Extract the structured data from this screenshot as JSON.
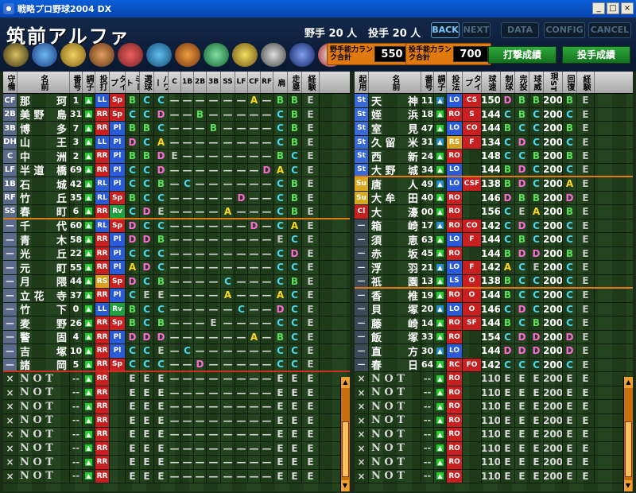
{
  "window": {
    "title": "戦略プロ野球2004 DX"
  },
  "team": {
    "name": "筑前アルファ",
    "fielders": "野手 20 人",
    "pitchers": "投手 20 人"
  },
  "topnav": [
    "BACK",
    "NEXT",
    "DATA",
    "CONFIG",
    "CANCEL"
  ],
  "rank": {
    "fielder_label": "野手能力ランク合計",
    "fielder_value": "550",
    "pitcher_label": "投手能力ランク合計",
    "pitcher_value": "700"
  },
  "buttons": {
    "batting": "打撃成績",
    "pitching": "投手成績"
  },
  "colors": {
    "grade_A": "#ffd820",
    "grade_B": "#5ae05a",
    "grade_C": "#4ad8f0",
    "grade_D": "#ff6ad8",
    "grade_E": "#c8c8c8",
    "orange": "#e07a10"
  },
  "fielder_headers": [
    "守備",
    "名前",
    "番号",
    "調子",
    "投打",
    "タイプ",
    "ミート",
    "選球",
    "パワー",
    "C",
    "1B",
    "2B",
    "3B",
    "SS",
    "LF",
    "CF",
    "RF",
    "肩",
    "走塁",
    "経験"
  ],
  "pitcher_headers": [
    "起用",
    "名前",
    "番号",
    "調子",
    "投法",
    "タイプ",
    "球速",
    "制球",
    "完投",
    "球威",
    "現ST",
    "回復",
    "経験"
  ],
  "fielders": [
    {
      "pos": "CF",
      "n1": "那",
      "n2": "珂",
      "num": "1",
      "bat": "LL",
      "typ": "Sp",
      "m": "B",
      "s": "C",
      "p": "C",
      "f": [
        "",
        "",
        "",
        "",
        "",
        "",
        "A",
        ""
      ],
      "arm": "B",
      "run": "B",
      "exp": "E"
    },
    {
      "pos": "2B",
      "n1": "美 野",
      "n2": "島",
      "num": "31",
      "bat": "RR",
      "typ": "Sp",
      "m": "C",
      "s": "C",
      "p": "D",
      "f": [
        "",
        "",
        "B",
        "",
        "",
        "",
        "",
        ""
      ],
      "arm": "C",
      "run": "B",
      "exp": "E"
    },
    {
      "pos": "3B",
      "n1": "博",
      "n2": "多",
      "num": "7",
      "bat": "RR",
      "typ": "Pl",
      "m": "B",
      "s": "B",
      "p": "C",
      "f": [
        "",
        "",
        "",
        "B",
        "",
        "",
        "",
        ""
      ],
      "arm": "C",
      "run": "B",
      "exp": "E"
    },
    {
      "pos": "DH",
      "n1": "山",
      "n2": "王",
      "num": "3",
      "bat": "LL",
      "typ": "Pl",
      "m": "D",
      "s": "C",
      "p": "A",
      "f": [
        "",
        "",
        "",
        "",
        "",
        "",
        "",
        ""
      ],
      "arm": "C",
      "run": "B",
      "exp": "E"
    },
    {
      "pos": "C",
      "n1": "中",
      "n2": "洲",
      "num": "2",
      "bat": "RR",
      "typ": "Pl",
      "m": "B",
      "s": "B",
      "p": "D",
      "f": [
        "E",
        "",
        "",
        "",
        "",
        "",
        "",
        ""
      ],
      "arm": "B",
      "run": "C",
      "exp": "E"
    },
    {
      "pos": "LF",
      "n1": "半 道",
      "n2": "橋",
      "num": "69",
      "bat": "RR",
      "typ": "Pl",
      "m": "C",
      "s": "C",
      "p": "D",
      "f": [
        "",
        "",
        "",
        "",
        "",
        "",
        "",
        "D"
      ],
      "arm": "A",
      "run": "C",
      "exp": "E"
    },
    {
      "pos": "1B",
      "n1": "石",
      "n2": "城",
      "num": "42",
      "bat": "RL",
      "typ": "Pl",
      "m": "C",
      "s": "C",
      "p": "B",
      "f": [
        "",
        "C",
        "",
        "",
        "",
        "",
        "",
        ""
      ],
      "arm": "C",
      "run": "B",
      "exp": "E"
    },
    {
      "pos": "RF",
      "n1": "竹",
      "n2": "丘",
      "num": "35",
      "bat": "RL",
      "typ": "Sp",
      "m": "B",
      "s": "C",
      "p": "C",
      "f": [
        "",
        "",
        "",
        "",
        "",
        "D",
        "",
        ""
      ],
      "arm": "C",
      "run": "B",
      "exp": "E"
    },
    {
      "pos": "SS",
      "n1": "春",
      "n2": "町",
      "num": "6",
      "bat": "RR",
      "typ": "Rv",
      "m": "C",
      "s": "D",
      "p": "E",
      "f": [
        "",
        "",
        "",
        "",
        "A",
        "",
        "",
        ""
      ],
      "arm": "C",
      "run": "B",
      "exp": "E"
    },
    {
      "pos": "一",
      "n1": "千",
      "n2": "代",
      "num": "60",
      "bat": "RL",
      "typ": "Sp",
      "m": "D",
      "s": "C",
      "p": "C",
      "f": [
        "",
        "",
        "",
        "",
        "",
        "",
        "D",
        ""
      ],
      "arm": "C",
      "run": "A",
      "exp": "E"
    },
    {
      "pos": "一",
      "n1": "青",
      "n2": "木",
      "num": "58",
      "bat": "RR",
      "typ": "Pl",
      "m": "D",
      "s": "D",
      "p": "B",
      "f": [
        "",
        "",
        "",
        "",
        "",
        "",
        "",
        ""
      ],
      "arm": "E",
      "run": "C",
      "exp": "E"
    },
    {
      "pos": "一",
      "n1": "光",
      "n2": "丘",
      "num": "22",
      "bat": "RR",
      "typ": "Pl",
      "m": "C",
      "s": "C",
      "p": "C",
      "f": [
        "",
        "",
        "",
        "",
        "",
        "",
        "",
        ""
      ],
      "arm": "C",
      "run": "D",
      "exp": "E"
    },
    {
      "pos": "一",
      "n1": "元",
      "n2": "町",
      "num": "55",
      "bat": "RR",
      "typ": "Pl",
      "m": "A",
      "s": "D",
      "p": "C",
      "f": [
        "",
        "",
        "",
        "",
        "",
        "",
        "",
        ""
      ],
      "arm": "C",
      "run": "C",
      "exp": "E"
    },
    {
      "pos": "一",
      "n1": "月",
      "n2": "隈",
      "num": "44",
      "bat": "RS",
      "typ": "Sp",
      "m": "D",
      "s": "C",
      "p": "B",
      "f": [
        "",
        "",
        "",
        "",
        "C",
        "",
        "",
        ""
      ],
      "arm": "C",
      "run": "B",
      "exp": "E"
    },
    {
      "pos": "一",
      "n1": "立 花",
      "n2": "寺",
      "num": "37",
      "bat": "RR",
      "typ": "Pl",
      "m": "C",
      "s": "E",
      "p": "E",
      "f": [
        "",
        "",
        "",
        "",
        "A",
        "",
        "",
        ""
      ],
      "arm": "A",
      "run": "C",
      "exp": "E"
    },
    {
      "pos": "一",
      "n1": "竹",
      "n2": "下",
      "num": "0",
      "bat": "LL",
      "typ": "Rv",
      "m": "B",
      "s": "C",
      "p": "C",
      "f": [
        "",
        "",
        "",
        "",
        "",
        "C",
        "",
        ""
      ],
      "arm": "D",
      "run": "C",
      "exp": "E"
    },
    {
      "pos": "一",
      "n1": "麦",
      "n2": "野",
      "num": "26",
      "bat": "RR",
      "typ": "Sp",
      "m": "B",
      "s": "C",
      "p": "B",
      "f": [
        "",
        "",
        "",
        "E",
        "",
        "",
        "",
        ""
      ],
      "arm": "C",
      "run": "C",
      "exp": "E"
    },
    {
      "pos": "一",
      "n1": "警",
      "n2": "固",
      "num": "4",
      "bat": "RR",
      "typ": "Pl",
      "m": "D",
      "s": "D",
      "p": "D",
      "f": [
        "",
        "",
        "",
        "",
        "",
        "",
        "A",
        ""
      ],
      "arm": "B",
      "run": "C",
      "exp": "E"
    },
    {
      "pos": "一",
      "n1": "吉",
      "n2": "塚",
      "num": "10",
      "bat": "RR",
      "typ": "Pl",
      "m": "C",
      "s": "C",
      "p": "E",
      "f": [
        "",
        "C",
        "",
        "",
        "",
        "",
        "",
        ""
      ],
      "arm": "C",
      "run": "C",
      "exp": "E"
    },
    {
      "pos": "一",
      "n1": "諸",
      "n2": "岡",
      "num": "5",
      "bat": "RR",
      "typ": "Sp",
      "m": "C",
      "s": "C",
      "p": "C",
      "f": [
        "",
        "",
        "D",
        "",
        "",
        "",
        "",
        ""
      ],
      "arm": "C",
      "run": "C",
      "exp": "E"
    }
  ],
  "pitchers": [
    {
      "role": "St",
      "n1": "天",
      "n2": "神",
      "num": "11",
      "hand": "LO",
      "typ": "CS",
      "v": "150",
      "ctl": "D",
      "cg": "B",
      "pw": "B",
      "st": "200",
      "rec": "B",
      "exp": "E"
    },
    {
      "role": "St",
      "n1": "姪",
      "n2": "浜",
      "num": "18",
      "hand": "RO",
      "typ": "S",
      "v": "144",
      "ctl": "C",
      "cg": "B",
      "pw": "C",
      "st": "200",
      "rec": "C",
      "exp": "E"
    },
    {
      "role": "St",
      "n1": "室",
      "n2": "見",
      "num": "47",
      "hand": "LO",
      "typ": "CO",
      "v": "144",
      "ctl": "B",
      "cg": "C",
      "pw": "C",
      "st": "200",
      "rec": "B",
      "exp": "E"
    },
    {
      "role": "St",
      "n1": "久 留",
      "n2": "米",
      "num": "31",
      "hand": "RS",
      "typ": "F",
      "v": "134",
      "ctl": "C",
      "cg": "D",
      "pw": "C",
      "st": "200",
      "rec": "C",
      "exp": "E"
    },
    {
      "role": "St",
      "n1": "西",
      "n2": "新",
      "num": "24",
      "hand": "RO",
      "typ": "",
      "v": "148",
      "ctl": "C",
      "cg": "C",
      "pw": "B",
      "st": "200",
      "rec": "B",
      "exp": "E"
    },
    {
      "role": "St",
      "n1": "大 野",
      "n2": "城",
      "num": "34",
      "hand": "LO",
      "typ": "",
      "v": "144",
      "ctl": "B",
      "cg": "D",
      "pw": "C",
      "st": "200",
      "rec": "C",
      "exp": "E"
    },
    {
      "role": "Su",
      "n1": "唐",
      "n2": "人",
      "num": "49",
      "hand": "LO",
      "typ": "CSF",
      "v": "138",
      "ctl": "B",
      "cg": "D",
      "pw": "C",
      "st": "200",
      "rec": "A",
      "exp": "E"
    },
    {
      "role": "Su",
      "n1": "大 牟",
      "n2": "田",
      "num": "40",
      "hand": "RO",
      "typ": "",
      "v": "146",
      "ctl": "D",
      "cg": "B",
      "pw": "B",
      "st": "200",
      "rec": "D",
      "exp": "E"
    },
    {
      "role": "Cl",
      "n1": "大",
      "n2": "濠",
      "num": "00",
      "hand": "RO",
      "typ": "",
      "v": "156",
      "ctl": "C",
      "cg": "E",
      "pw": "A",
      "st": "200",
      "rec": "B",
      "exp": "E"
    },
    {
      "role": "一",
      "n1": "箱",
      "n2": "崎",
      "num": "17",
      "hand": "RO",
      "typ": "CO",
      "v": "142",
      "ctl": "C",
      "cg": "D",
      "pw": "C",
      "st": "200",
      "rec": "C",
      "exp": "E"
    },
    {
      "role": "一",
      "n1": "須",
      "n2": "恵",
      "num": "63",
      "hand": "LO",
      "typ": "F",
      "v": "144",
      "ctl": "C",
      "cg": "B",
      "pw": "C",
      "st": "200",
      "rec": "C",
      "exp": "E"
    },
    {
      "role": "一",
      "n1": "赤",
      "n2": "坂",
      "num": "45",
      "hand": "RO",
      "typ": "",
      "v": "144",
      "ctl": "B",
      "cg": "D",
      "pw": "D",
      "st": "200",
      "rec": "B",
      "exp": "E"
    },
    {
      "role": "一",
      "n1": "浮",
      "n2": "羽",
      "num": "21",
      "hand": "LO",
      "typ": "F",
      "v": "142",
      "ctl": "A",
      "cg": "C",
      "pw": "E",
      "st": "200",
      "rec": "C",
      "exp": "E"
    },
    {
      "role": "一",
      "n1": "祇",
      "n2": "園",
      "num": "13",
      "hand": "LS",
      "typ": "O",
      "v": "138",
      "ctl": "B",
      "cg": "C",
      "pw": "C",
      "st": "200",
      "rec": "C",
      "exp": "E"
    },
    {
      "role": "一",
      "n1": "香",
      "n2": "椎",
      "num": "19",
      "hand": "RO",
      "typ": "O",
      "v": "144",
      "ctl": "B",
      "cg": "C",
      "pw": "C",
      "st": "200",
      "rec": "C",
      "exp": "E"
    },
    {
      "role": "一",
      "n1": "貝",
      "n2": "塚",
      "num": "20",
      "hand": "LO",
      "typ": "O",
      "v": "146",
      "ctl": "C",
      "cg": "D",
      "pw": "C",
      "st": "200",
      "rec": "C",
      "exp": "E"
    },
    {
      "role": "一",
      "n1": "藤",
      "n2": "崎",
      "num": "14",
      "hand": "RO",
      "typ": "SF",
      "v": "144",
      "ctl": "B",
      "cg": "C",
      "pw": "B",
      "st": "200",
      "rec": "C",
      "exp": "E"
    },
    {
      "role": "一",
      "n1": "飯",
      "n2": "塚",
      "num": "33",
      "hand": "RO",
      "typ": "",
      "v": "154",
      "ctl": "C",
      "cg": "D",
      "pw": "D",
      "st": "200",
      "rec": "D",
      "exp": "E"
    },
    {
      "role": "一",
      "n1": "直",
      "n2": "方",
      "num": "30",
      "hand": "LO",
      "typ": "",
      "v": "144",
      "ctl": "D",
      "cg": "D",
      "pw": "D",
      "st": "200",
      "rec": "D",
      "exp": "E"
    },
    {
      "role": "一",
      "n1": "春",
      "n2": "日",
      "num": "64",
      "hand": "RC",
      "typ": "FO",
      "v": "142",
      "ctl": "C",
      "cg": "C",
      "pw": "C",
      "st": "200",
      "rec": "C",
      "exp": "E"
    }
  ],
  "empty_row": {
    "mark": "×",
    "name": "N O T",
    "num": "--",
    "grade": "E",
    "v": "110",
    "st": "200"
  }
}
